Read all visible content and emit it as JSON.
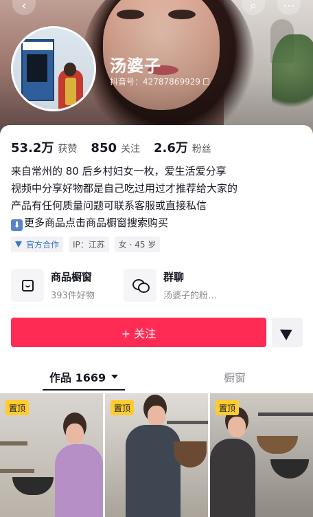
{
  "header": {
    "back_icon": "chevron-left-icon",
    "search_icon": "search-icon",
    "more_icon": "more-icon"
  },
  "profile": {
    "nickname": "汤婆子",
    "douyin_id": "抖音号：42787869929"
  },
  "stats": [
    {
      "value": "53.2万",
      "label": "获赞"
    },
    {
      "value": "850",
      "label": "关注"
    },
    {
      "value": "2.6万",
      "label": "粉丝"
    }
  ],
  "bio": {
    "line1": "来自常州的 80 后乡村妇女一枚，爱生活爱分享",
    "line2": "视频中分享好物都是自己吃过用过才推荐给大家的",
    "line3": "产品有任何质量问题可联系客服或直接私信",
    "line4": "更多商品点击商品橱窗搜索购买"
  },
  "tags": {
    "official": "官方合作",
    "ip": "IP：江苏",
    "gender_age": "女 · 45 岁"
  },
  "entries": {
    "shop_title": "商品橱窗",
    "shop_sub": "393件好物",
    "group_title": "群聊",
    "group_sub": "汤婆子的粉…"
  },
  "actions": {
    "follow_label": "+ 关注"
  },
  "tabs": {
    "works_label": "作品 1669",
    "window_label": "橱窗"
  },
  "videos": [
    {
      "badge": "置顶"
    },
    {
      "badge": "置顶"
    },
    {
      "badge": "置顶"
    }
  ],
  "colors": {
    "accent": "#fe2c55",
    "pin": "#fecc2f",
    "official": "#3b74c9"
  }
}
